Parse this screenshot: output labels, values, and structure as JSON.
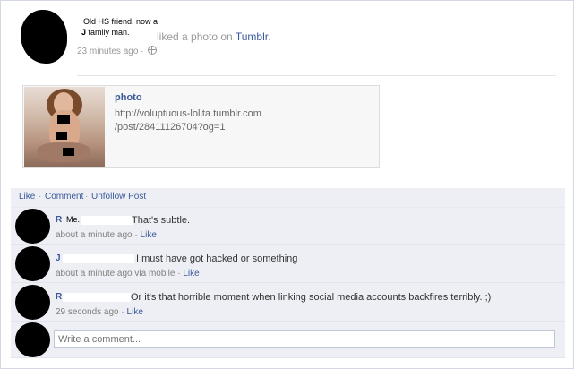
{
  "story": {
    "author_line_1": "Old HS friend, now a",
    "author_initial": "J",
    "author_line_2": "family man.",
    "action_prefix": "liked a photo on",
    "action_app": "Tumblr",
    "action_suffix": ".",
    "time": "23 minutes ago",
    "time_sep": "·",
    "privacy_icon": "globe-icon"
  },
  "attachment": {
    "title": "photo",
    "url_line_1": "http://voluptuous-lolita.tumblr.com",
    "url_line_2": "/post/28411126704?og=1"
  },
  "actions": {
    "like": "Like",
    "sep": "·",
    "comment": "Comment",
    "unfollow": "Unfollow Post"
  },
  "comments": [
    {
      "initial": "R",
      "name_extra": "Me.",
      "text": "That's subtle.",
      "time": "about a minute ago",
      "via": "",
      "sep": "·",
      "like": "Like"
    },
    {
      "initial": "J",
      "name_extra": "",
      "text": "I must have got hacked or something",
      "time": "about a minute ago",
      "via": "via mobile",
      "sep": "·",
      "like": "Like"
    },
    {
      "initial": "R",
      "name_extra": "",
      "text": "Or it's that horrible moment when linking social media accounts backfires terribly. ;)",
      "time": "29 seconds ago",
      "via": "",
      "sep": "·",
      "like": "Like"
    }
  ],
  "composer": {
    "placeholder": "Write a comment..."
  },
  "colors": {
    "link": "#3b5998",
    "panel": "#edeff4",
    "redaction": "#000000"
  }
}
